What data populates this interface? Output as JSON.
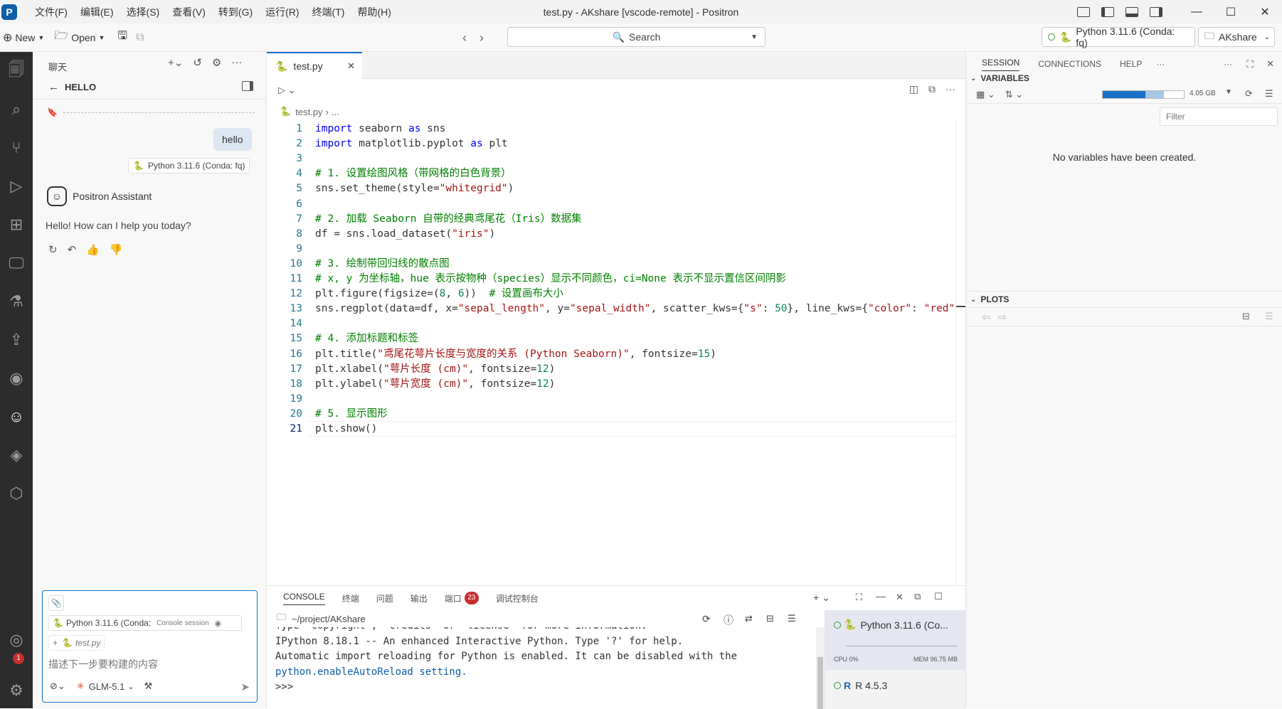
{
  "titlebar": {
    "title": "test.py - AKshare [vscode-remote] - Positron",
    "menus": [
      "文件(F)",
      "编辑(E)",
      "选择(S)",
      "查看(V)",
      "转到(G)",
      "运行(R)",
      "终端(T)",
      "帮助(H)"
    ]
  },
  "toolbar": {
    "new_label": "New",
    "open_label": "Open",
    "search_label": "Search",
    "interpreter_label": "Python 3.11.6 (Conda: fq)",
    "folder_label": "AKshare"
  },
  "chat": {
    "header_title": "聊天",
    "session_title": "HELLO",
    "user_message": "hello",
    "user_interpreter": "Python 3.11.6 (Conda: fq)",
    "assistant_name": "Positron Assistant",
    "assistant_message": "Hello! How can I help you today?",
    "input_interpreter": "Python 3.11.6 (Conda:",
    "input_session": "Console session",
    "attached_file": "test.py",
    "input_placeholder": "描述下一步要构建的内容",
    "model_label": "GLM-5.1",
    "badge_count": "1"
  },
  "editor": {
    "tab_label": "test.py",
    "breadcrumb_file": "test.py",
    "breadcrumb_more": "...",
    "lines": [
      "import seaborn as sns",
      "import matplotlib.pyplot as plt",
      "",
      "# 1. 设置绘图风格（带网格的白色背景）",
      "sns.set_theme(style=\"whitegrid\")",
      "",
      "# 2. 加载 Seaborn 自带的经典鸢尾花（Iris）数据集",
      "df = sns.load_dataset(\"iris\")",
      "",
      "# 3. 绘制带回归线的散点图",
      "# x, y 为坐标轴，hue 表示按物种（species）显示不同颜色，ci=None 表示不显示置信区间阴影",
      "plt.figure(figsize=(8, 6))  # 设置画布大小",
      "sns.regplot(data=df, x=\"sepal_length\", y=\"sepal_width\", scatter_kws={\"s\": 50}, line_kws={\"color\": \"red\"",
      "",
      "# 4. 添加标题和标签",
      "plt.title(\"鸢尾花萼片长度与宽度的关系 (Python Seaborn)\", fontsize=15)",
      "plt.xlabel(\"萼片长度 (cm)\", fontsize=12)",
      "plt.ylabel(\"萼片宽度 (cm)\", fontsize=12)",
      "",
      "# 5. 显示图形",
      "plt.show()"
    ]
  },
  "session": {
    "tabs": [
      "SESSION",
      "CONNECTIONS",
      "HELP"
    ],
    "variables_header": "VARIABLES",
    "memory_label": "4.05 GB",
    "memory_fraction": 0.75,
    "filter_placeholder": "Filter",
    "empty_message": "No variables have been created.",
    "plots_header": "PLOTS"
  },
  "console": {
    "tabs": [
      "CONSOLE",
      "终端",
      "问题",
      "输出",
      "端口",
      "调试控制台"
    ],
    "ports_badge": "23",
    "path": "~/project/AKshare",
    "lines": [
      "Type \"copyright\", \"credits\" or \"license\" for more information.",
      "IPython 8.18.1 -- An enhanced Interactive Python. Type '?' for help.",
      "Automatic import reloading for Python is enabled. It can be disabled with the",
      "python.enableAutoReload setting.",
      ">>>"
    ],
    "sessions": [
      {
        "label": "Python 3.11.6 (Co...",
        "cpu": "CPU 0%",
        "mem": "MEM 96.75 MB"
      },
      {
        "label": "R 4.5.3"
      }
    ]
  }
}
